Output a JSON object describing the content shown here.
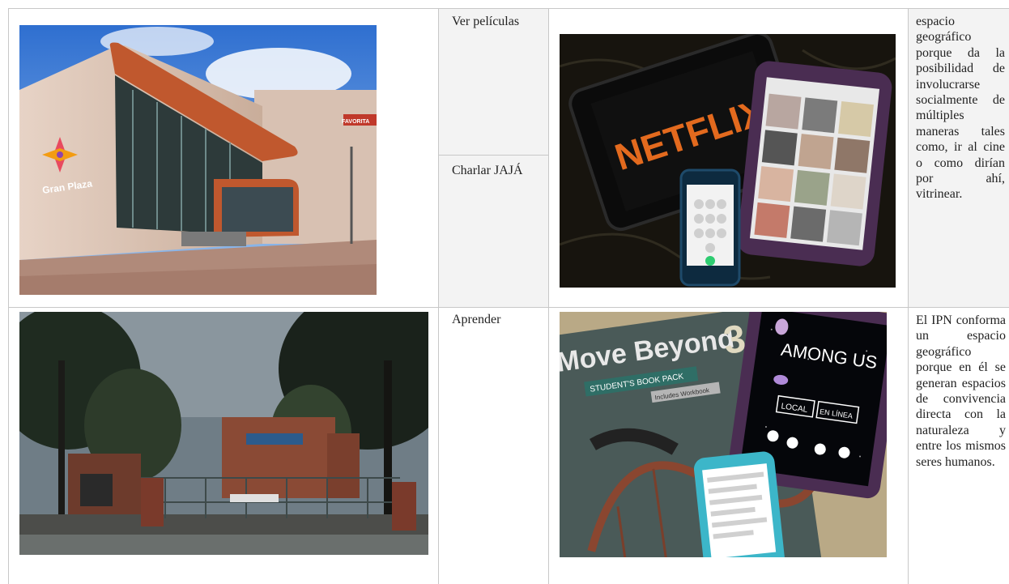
{
  "rows": [
    {
      "activities": [
        "Ver películas",
        "Charlar JAJÁ"
      ],
      "description": "espacio geográfico porque da la posibilidad de involucrarse socialmente de múltiples maneras tales como, ir al cine o como dirían por ahí, vitrinear.",
      "photo_left": {
        "sign_text": "Gran Plaza",
        "brand_text": "FAVORITA"
      },
      "photo_right": {
        "screen_text": "NETFLIX"
      }
    },
    {
      "activities": [
        "Aprender"
      ],
      "description": "El IPN conforma un espacio geográfico porque en él se generan espacios de convivencia directa con la naturaleza y entre los mismos seres humanos.",
      "photo_left": {},
      "photo_right": {
        "book_title": "Move Beyond",
        "book_number": "3",
        "book_sub": "STUDENT'S BOOK PACK",
        "book_sub2": "Includes Workbook",
        "game_title": "AMONG US",
        "game_btn1": "LOCAL",
        "game_btn2": "EN LÍNEA"
      }
    }
  ],
  "colors": {
    "grid_line": "#c8c8c8",
    "shaded_cell": "#f3f3f3",
    "text": "#222222"
  }
}
